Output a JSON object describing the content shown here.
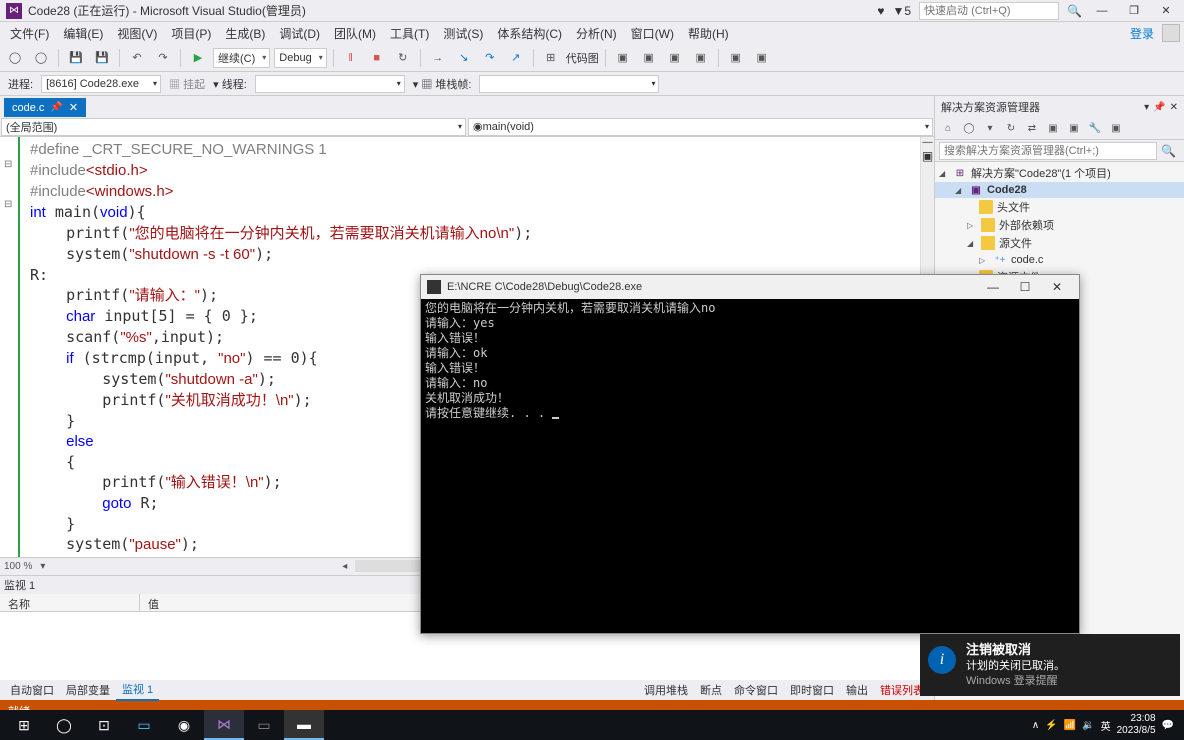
{
  "titlebar": {
    "title": "Code28 (正在运行) - Microsoft Visual Studio(管理员)",
    "notif_count": "5",
    "quick_launch_placeholder": "快速启动 (Ctrl+Q)"
  },
  "menubar": {
    "items": [
      "文件(F)",
      "编辑(E)",
      "视图(V)",
      "项目(P)",
      "生成(B)",
      "调试(D)",
      "团队(M)",
      "工具(T)",
      "测试(S)",
      "体系结构(C)",
      "分析(N)",
      "窗口(W)",
      "帮助(H)"
    ],
    "login": "登录"
  },
  "toolbar": {
    "continue_label": "继续(C)",
    "config": "Debug",
    "codemap": "代码图"
  },
  "process_bar": {
    "label_proc": "进程:",
    "process": "[8616] Code28.exe",
    "suspend": "挂起",
    "label_thread": "线程:",
    "label_stack": "堆栈帧:"
  },
  "editor": {
    "tab": "code.c",
    "scope_left": "(全局范围)",
    "scope_right": "main(void)",
    "zoom": "100 %",
    "code_lines": [
      {
        "t": "#define _CRT_SECURE_NO_WARNINGS 1",
        "cls": "pre"
      },
      {
        "raw": true,
        "html": "<span class='pre'>#include</span><span class='str'>&lt;stdio.h&gt;</span>"
      },
      {
        "raw": true,
        "html": "<span class='pre'>#include</span><span class='str'>&lt;windows.h&gt;</span>"
      },
      {
        "raw": true,
        "html": "<span class='kw'>int</span> main(<span class='kw'>void</span>){"
      },
      {
        "raw": true,
        "html": "    printf(<span class='str'>\"您的电脑将在一分钟内关机，若需要取消关机请输入no\\n\"</span>);"
      },
      {
        "raw": true,
        "html": "    system(<span class='str'>\"shutdown -s -t 60\"</span>);"
      },
      {
        "t": "R:"
      },
      {
        "raw": true,
        "html": "    printf(<span class='str'>\"请输入：\"</span>);"
      },
      {
        "raw": true,
        "html": "    <span class='kw'>char</span> input[5] = { 0 };"
      },
      {
        "raw": true,
        "html": "    scanf(<span class='str'>\"%s\"</span>,input);"
      },
      {
        "raw": true,
        "html": "    <span class='kw'>if</span> (strcmp(input, <span class='str'>\"no\"</span>) == 0){"
      },
      {
        "raw": true,
        "html": "        system(<span class='str'>\"shutdown -a\"</span>);"
      },
      {
        "raw": true,
        "html": "        printf(<span class='str'>\"关机取消成功！\\n\"</span>);"
      },
      {
        "t": "    }"
      },
      {
        "raw": true,
        "html": "    <span class='kw'>else</span>"
      },
      {
        "t": "    {"
      },
      {
        "raw": true,
        "html": "        printf(<span class='str'>\"输入错误！\\n\"</span>);"
      },
      {
        "raw": true,
        "html": "        <span class='kw'>goto</span> R;"
      },
      {
        "t": "    }"
      },
      {
        "raw": true,
        "html": "    system(<span class='str'>\"pause\"</span>);"
      }
    ]
  },
  "watch": {
    "title": "监视 1",
    "cols": [
      "名称",
      "值"
    ],
    "bottom_tabs": [
      "自动窗口",
      "局部变量",
      "监视 1"
    ],
    "right_tabs": [
      "调用堆栈",
      "断点",
      "命令窗口",
      "即时窗口",
      "输出",
      "错误列表"
    ]
  },
  "solution": {
    "title": "解决方案资源管理器",
    "search_placeholder": "搜索解决方案资源管理器(Ctrl+;)",
    "root": "解决方案\"Code28\"(1 个项目)",
    "project": "Code28",
    "headers": "头文件",
    "external": "外部依赖项",
    "source": "源文件",
    "file": "code.c",
    "resource": "资源文件"
  },
  "statusbar": {
    "text": "就绪"
  },
  "console": {
    "title": "E:\\NCRE C\\Code28\\Debug\\Code28.exe",
    "lines": [
      "您的电脑将在一分钟内关机，若需要取消关机请输入no",
      "请输入：yes",
      "输入错误！",
      "请输入：ok",
      "输入错误！",
      "请输入：no",
      "关机取消成功！",
      "请按任意键继续. . . "
    ]
  },
  "toast": {
    "title": "注销被取消",
    "body": "计划的关闭已取消。",
    "footer": "Windows 登录提醒"
  },
  "taskbar": {
    "clock_time": "23:08",
    "clock_date": "2023/8/5",
    "ime": "英",
    "tray_icons": [
      "∧",
      "⚡",
      "🔉",
      "📶"
    ]
  }
}
